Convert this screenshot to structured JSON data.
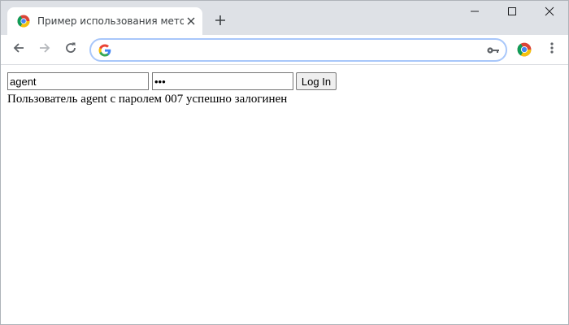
{
  "browser": {
    "tab": {
      "title": "Пример использования метода"
    },
    "omnibox": {
      "value": ""
    },
    "colors": {
      "tabstrip": "#dee1e6",
      "omnibox_focus": "#a8c7fa"
    },
    "icons": {
      "favicon": "chromium-logo-icon",
      "close": "close-icon",
      "new_tab": "plus-icon",
      "back": "arrow-left-icon",
      "forward": "arrow-right-icon",
      "reload": "reload-icon",
      "search_engine": "google-g-icon",
      "password_key": "key-icon",
      "extension": "chromium-logo-icon",
      "menu": "kebab-menu-icon"
    }
  },
  "page": {
    "login_form": {
      "username_value": "agent",
      "password_value": "007",
      "submit_label": "Log In"
    },
    "status_message": "Пользователь agent с паролем 007 успешно залогинен"
  }
}
